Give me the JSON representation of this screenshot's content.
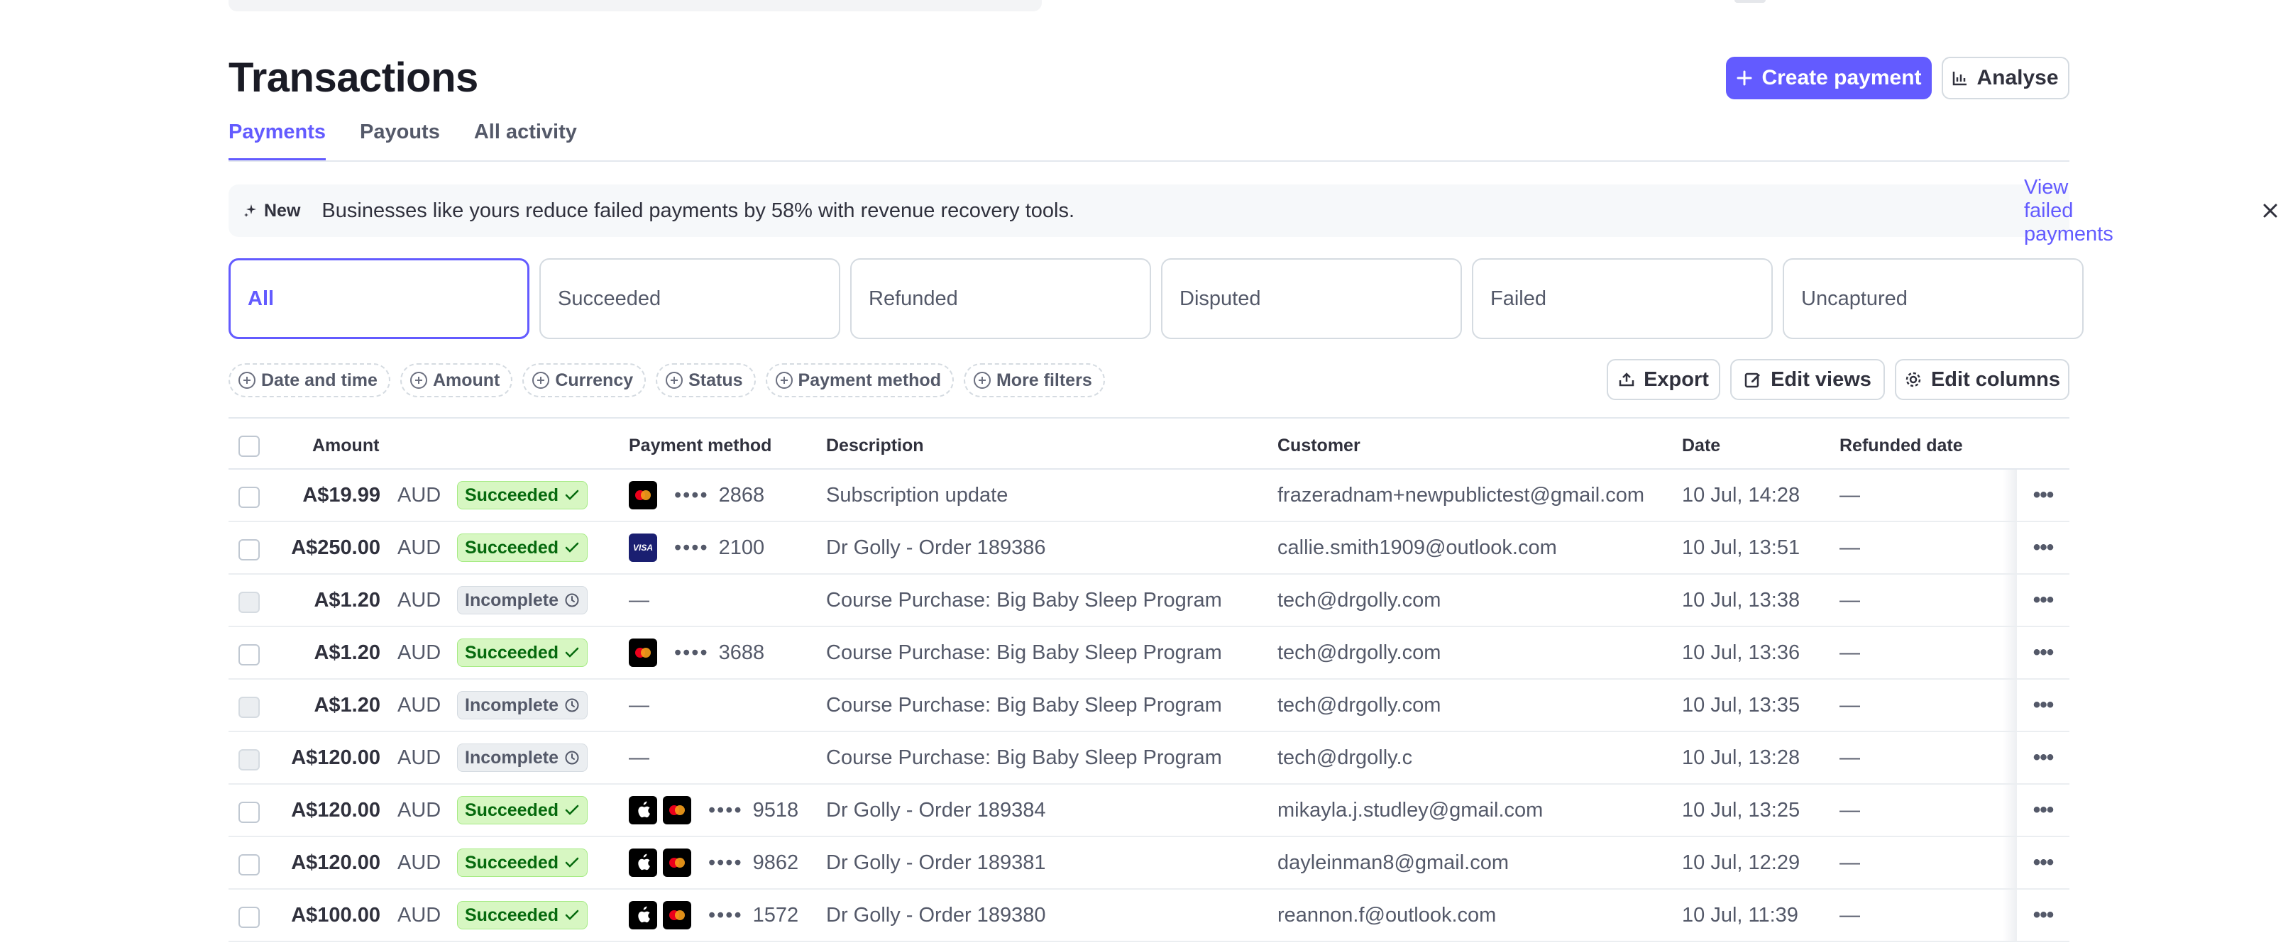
{
  "page": {
    "title": "Transactions"
  },
  "header_actions": {
    "create_payment": "Create payment",
    "analyse": "Analyse"
  },
  "tabs": [
    {
      "label": "Payments",
      "active": true
    },
    {
      "label": "Payouts",
      "active": false
    },
    {
      "label": "All activity",
      "active": false
    }
  ],
  "banner": {
    "badge": "New",
    "message": "Businesses like yours reduce failed payments by 58% with revenue recovery tools.",
    "link": "View failed payments"
  },
  "status_cards": [
    {
      "label": "All",
      "active": true
    },
    {
      "label": "Succeeded",
      "active": false
    },
    {
      "label": "Refunded",
      "active": false
    },
    {
      "label": "Disputed",
      "active": false
    },
    {
      "label": "Failed",
      "active": false
    },
    {
      "label": "Uncaptured",
      "active": false
    }
  ],
  "filters": [
    "Date and time",
    "Amount",
    "Currency",
    "Status",
    "Payment method",
    "More filters"
  ],
  "table_actions": {
    "export": "Export",
    "edit_views": "Edit views",
    "edit_columns": "Edit columns"
  },
  "columns": {
    "amount": "Amount",
    "payment_method": "Payment method",
    "description": "Description",
    "customer": "Customer",
    "date": "Date",
    "refunded_date": "Refunded date"
  },
  "rows": [
    {
      "amount": "A$19.99",
      "currency": "AUD",
      "status": "Succeeded",
      "pm_icons": [
        "mastercard"
      ],
      "pm_dots": "••••",
      "pm_last4": "2868",
      "description": "Subscription update",
      "customer": "frazeradnam+newpublictest@gmail.com",
      "date": "10 Jul, 14:28",
      "refunded": "—"
    },
    {
      "amount": "A$250.00",
      "currency": "AUD",
      "status": "Succeeded",
      "pm_icons": [
        "visa"
      ],
      "pm_dots": "••••",
      "pm_last4": "2100",
      "description": "Dr Golly - Order 189386",
      "customer": "callie.smith1909@outlook.com",
      "date": "10 Jul, 13:51",
      "refunded": "—"
    },
    {
      "amount": "A$1.20",
      "currency": "AUD",
      "status": "Incomplete",
      "pm_icons": [],
      "pm_dots": "—",
      "pm_last4": "",
      "description": "Course Purchase: Big Baby Sleep Program",
      "customer": "tech@drgolly.com",
      "date": "10 Jul, 13:38",
      "refunded": "—"
    },
    {
      "amount": "A$1.20",
      "currency": "AUD",
      "status": "Succeeded",
      "pm_icons": [
        "mastercard"
      ],
      "pm_dots": "••••",
      "pm_last4": "3688",
      "description": "Course Purchase: Big Baby Sleep Program",
      "customer": "tech@drgolly.com",
      "date": "10 Jul, 13:36",
      "refunded": "—"
    },
    {
      "amount": "A$1.20",
      "currency": "AUD",
      "status": "Incomplete",
      "pm_icons": [],
      "pm_dots": "—",
      "pm_last4": "",
      "description": "Course Purchase: Big Baby Sleep Program",
      "customer": "tech@drgolly.com",
      "date": "10 Jul, 13:35",
      "refunded": "—"
    },
    {
      "amount": "A$120.00",
      "currency": "AUD",
      "status": "Incomplete",
      "pm_icons": [],
      "pm_dots": "—",
      "pm_last4": "",
      "description": "Course Purchase: Big Baby Sleep Program",
      "customer": "tech@drgolly.c",
      "date": "10 Jul, 13:28",
      "refunded": "—"
    },
    {
      "amount": "A$120.00",
      "currency": "AUD",
      "status": "Succeeded",
      "pm_icons": [
        "apple-pay",
        "mastercard"
      ],
      "pm_dots": "••••",
      "pm_last4": "9518",
      "description": "Dr Golly - Order 189384",
      "customer": "mikayla.j.studley@gmail.com",
      "date": "10 Jul, 13:25",
      "refunded": "—"
    },
    {
      "amount": "A$120.00",
      "currency": "AUD",
      "status": "Succeeded",
      "pm_icons": [
        "apple-pay",
        "mastercard"
      ],
      "pm_dots": "••••",
      "pm_last4": "9862",
      "description": "Dr Golly - Order 189381",
      "customer": "dayleinman8@gmail.com",
      "date": "10 Jul, 12:29",
      "refunded": "—"
    },
    {
      "amount": "A$100.00",
      "currency": "AUD",
      "status": "Succeeded",
      "pm_icons": [
        "apple-pay",
        "mastercard"
      ],
      "pm_dots": "••••",
      "pm_last4": "1572",
      "description": "Dr Golly - Order 189380",
      "customer": "reannon.f@outlook.com",
      "date": "10 Jul, 11:39",
      "refunded": "—"
    }
  ],
  "colors": {
    "accent": "#635bff",
    "succeeded_bg": "#d7f7c2",
    "succeeded_text": "#05690d",
    "incomplete_bg": "#ebeef1"
  }
}
